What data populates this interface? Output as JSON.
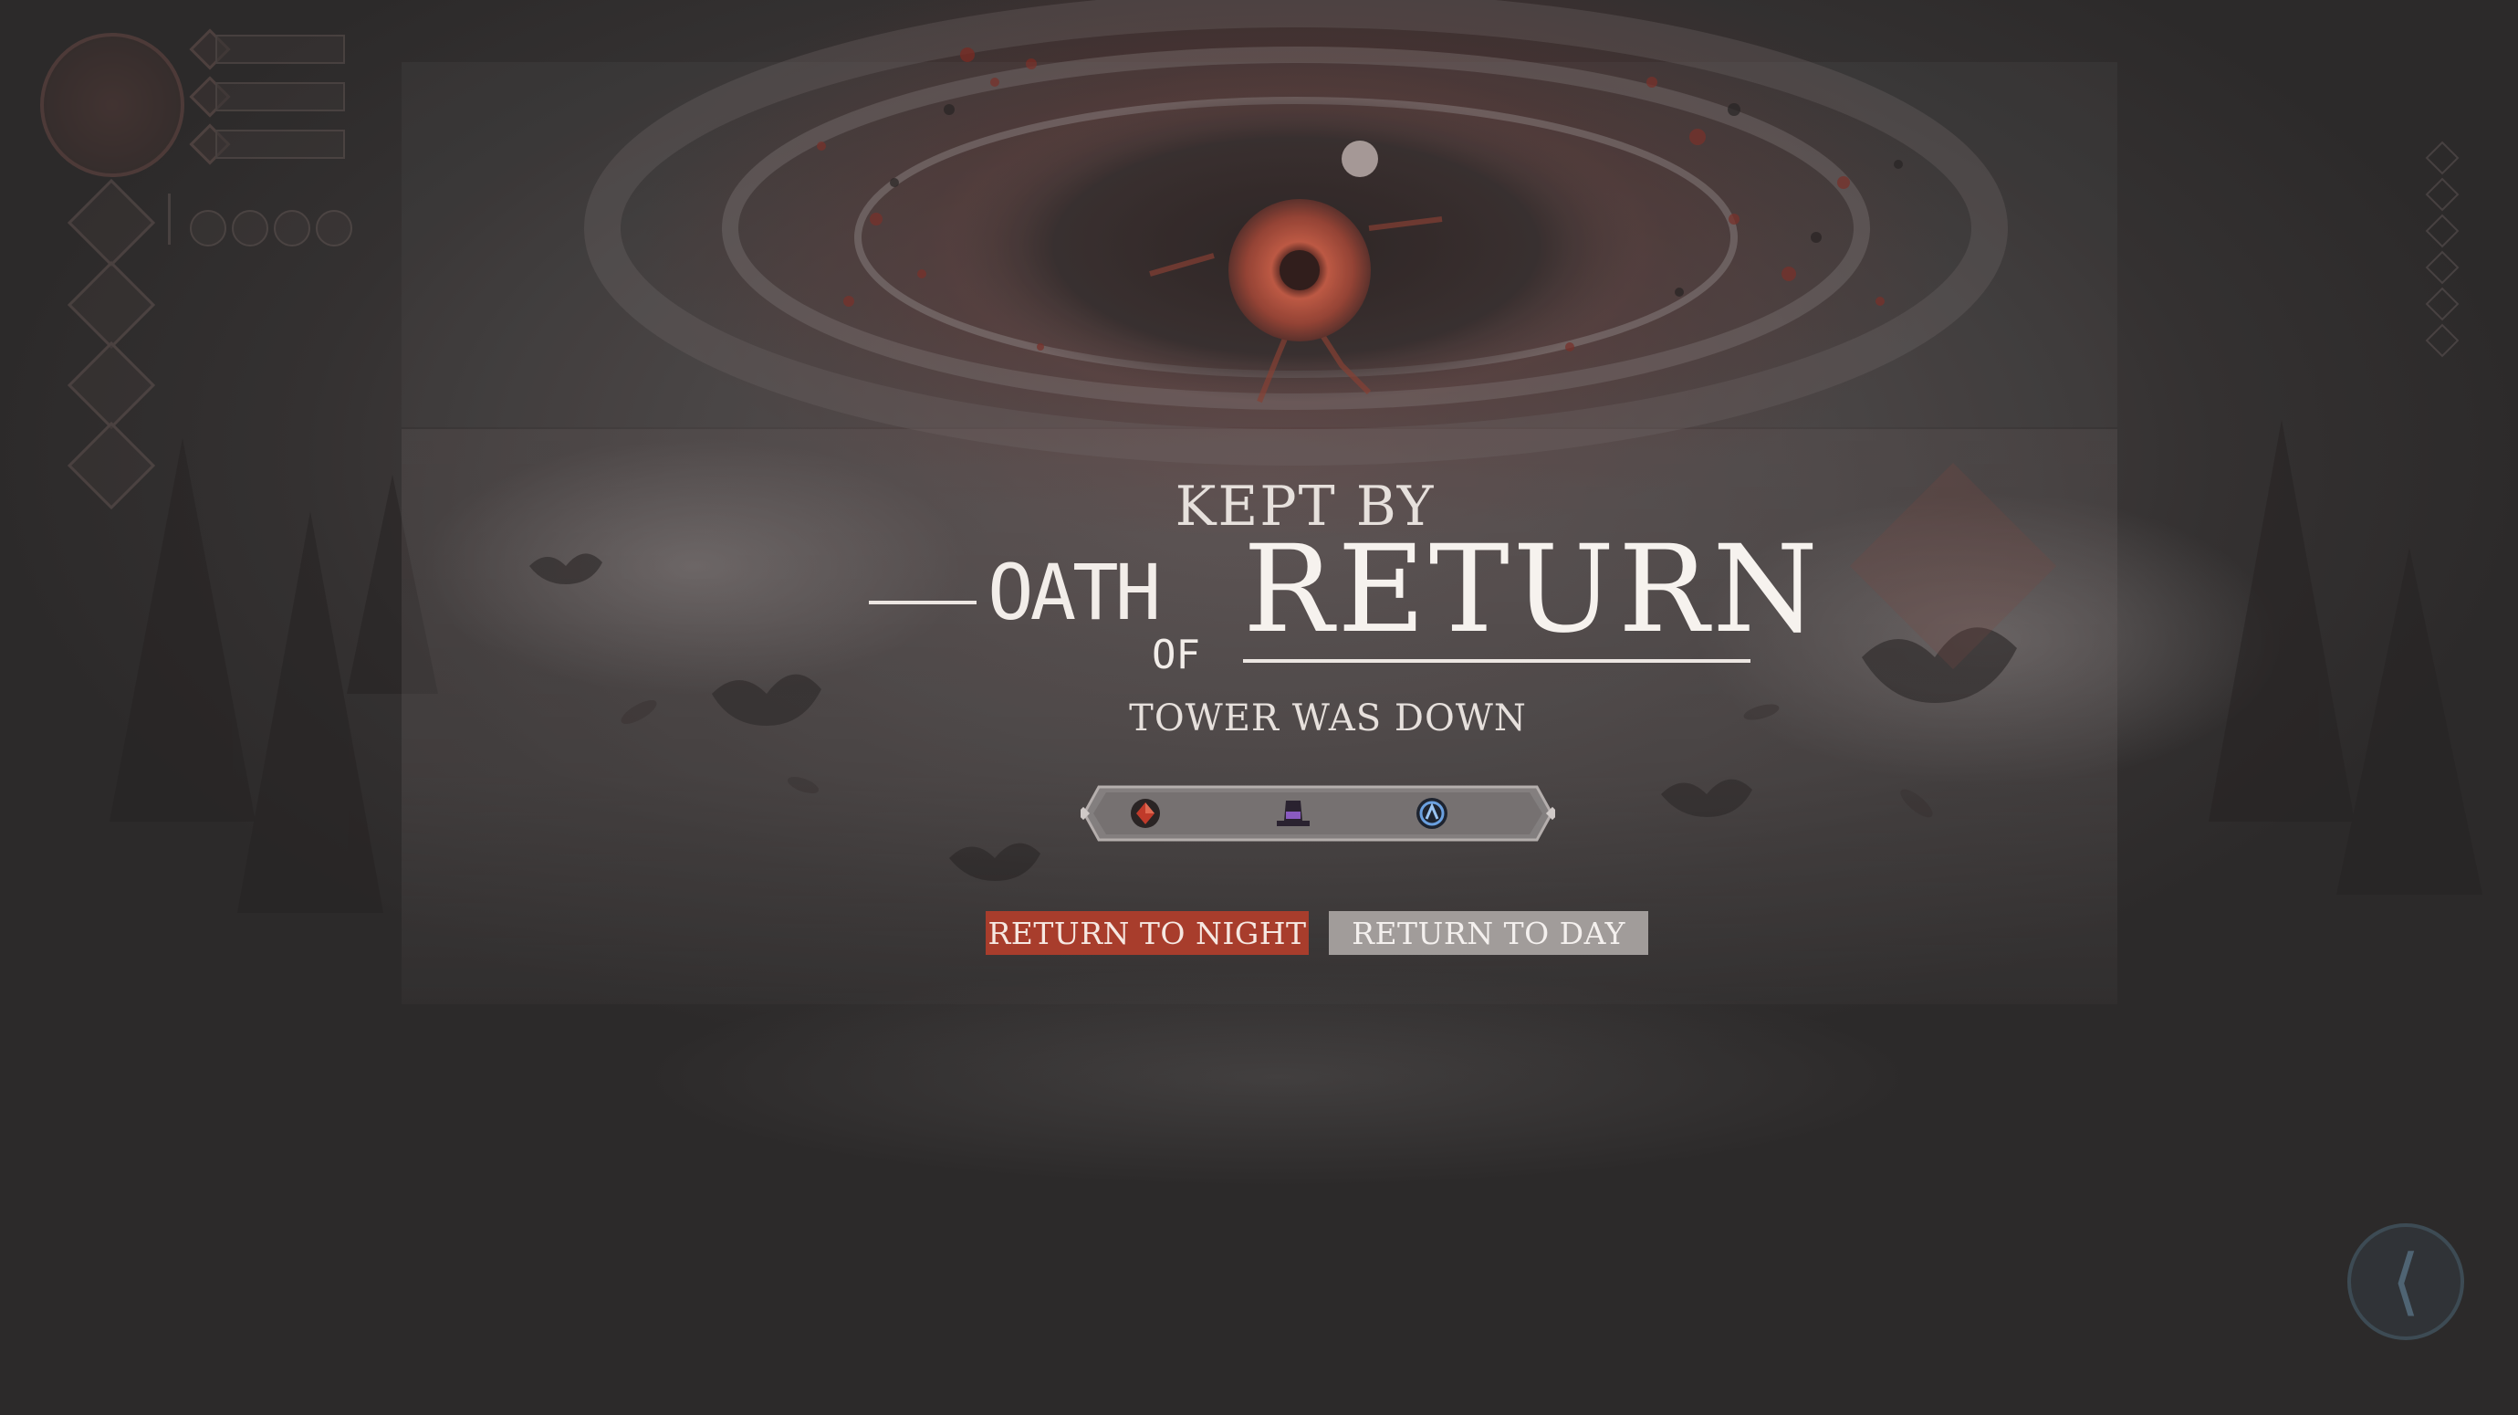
{
  "result": {
    "kept_by": "KEPT BY",
    "title_oath": "OATH",
    "title_of": "OF",
    "title_return": "RETURN",
    "subtitle": "TOWER WAS DOWN"
  },
  "icons": [
    "red-gem-icon",
    "purple-hat-icon",
    "blue-rune-icon"
  ],
  "buttons": {
    "night_label": "RETURN TO NIGHT",
    "day_label": "RETURN TO DAY"
  },
  "colors": {
    "night_button": "#a83d2c",
    "day_button": "#a19c9a",
    "eye_iris": "#c8573f"
  }
}
